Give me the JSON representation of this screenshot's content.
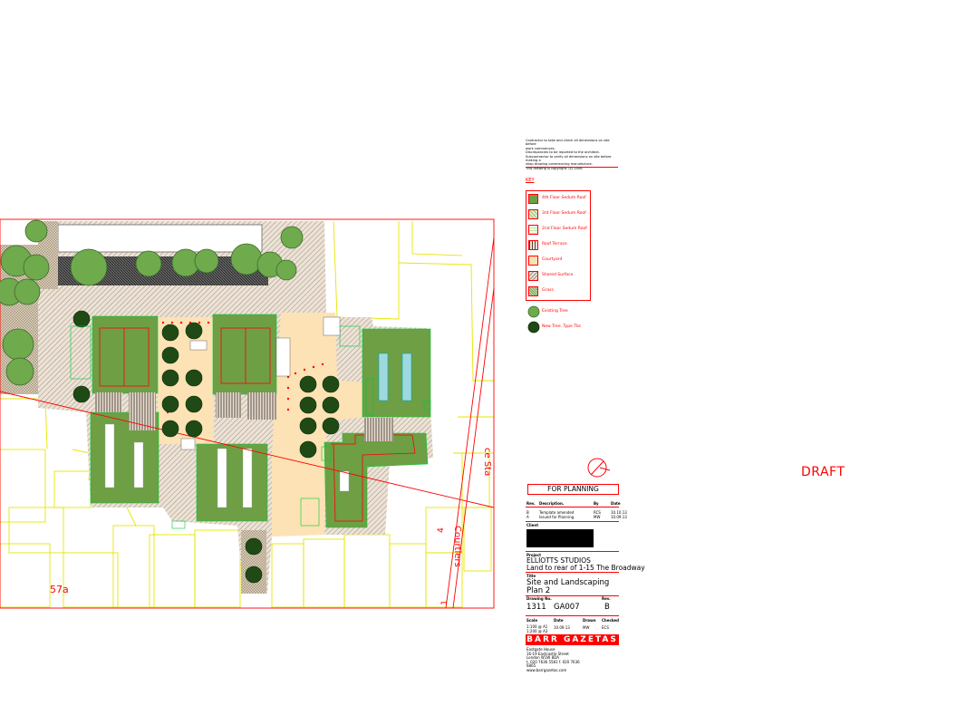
{
  "notes": {
    "lines": [
      "Contractor to take and check all dimensions on site before",
      "work commences.",
      "Discrepancies to be reported to the architect.",
      "Subcontractor to verify all dimensions on site before making a",
      "shop drawing commencing manufacture.",
      "This drawing is copyright. (c) 2006"
    ]
  },
  "key": {
    "heading": "KEY",
    "items": [
      {
        "label": "4th Floor Sedum Roof",
        "swatch": "#6e9f45"
      },
      {
        "label": "3rd Floor Sedum Roof",
        "swatch": "#9fc47a"
      },
      {
        "label": "2nd Floor Sedum Roof",
        "swatch": "#c9e2a8"
      },
      {
        "label": "Roof Terrace",
        "swatch": "#8a7a6a"
      },
      {
        "label": "Courtyard",
        "swatch": "#fbe0b0"
      },
      {
        "label": "Shared Surface",
        "swatch": "#e6d7c4"
      },
      {
        "label": "Grass",
        "swatch": "#7fae5a"
      }
    ],
    "trees": [
      {
        "label": "Existing Tree",
        "icon": "existing-tree-icon"
      },
      {
        "label": "New Tree. Type Tbc",
        "icon": "new-tree-icon"
      }
    ]
  },
  "stamp": "FOR PLANNING",
  "draft": "DRAFT",
  "revisions": {
    "headers": [
      "Rev.",
      "Description.",
      "By",
      "Date"
    ],
    "rows": [
      [
        "B",
        "Template amended",
        "RCS",
        "10.10.13"
      ],
      [
        "A",
        "Issued for Planning",
        "MW",
        "10.09.13"
      ]
    ]
  },
  "client_label": "Client",
  "project": {
    "label": "Project",
    "name": "ELLIOTTS STUDIOS",
    "address": "Land to rear of 1-15 The Broadway"
  },
  "title": {
    "label": "Title",
    "line1": "Site and Landscaping",
    "line2": "Plan 2"
  },
  "drawing": {
    "label": "Drawing No.",
    "rev_label": "Rev.",
    "job": "1311",
    "number": "GA007",
    "rev": "B"
  },
  "meta": {
    "headers": [
      "Scale",
      "Date",
      "Drawn",
      "Checked"
    ],
    "values": [
      "1:100 @ A1\n1:200 @ A3",
      "10.09.13",
      "MW",
      "ECS"
    ]
  },
  "firm": {
    "name": "BARR GAZETAS",
    "address": [
      "Eastgate House",
      "16-19 Eastcastle Street",
      "London W1W 8DA",
      "t. 020 7636 5581   f. 020 7636",
      "6865",
      "www.barrgazetas.com"
    ]
  },
  "site_labels": {
    "plot": "57a",
    "street": "Courtlers",
    "street2": "ce Sta",
    "num1": "1",
    "num4": "4"
  },
  "colors": {
    "line_red": "#ff0000",
    "line_yellow": "#e8e800",
    "line_green": "#00cc33",
    "firm_bg": "#ff0000"
  }
}
